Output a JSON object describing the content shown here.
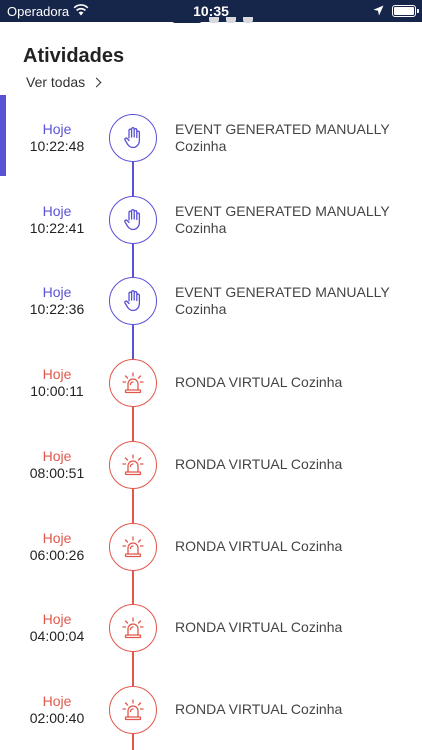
{
  "status_bar": {
    "carrier": "Operadora",
    "time": "10:35"
  },
  "section": {
    "title": "Atividades",
    "see_all": "Ver todas"
  },
  "colors": {
    "manual": "#5a52d5",
    "virtual": "#e0584c",
    "status_bar": "#16264a"
  },
  "activities": [
    {
      "type": "manual",
      "icon": "hand-icon",
      "day": "Hoje",
      "time": "10:22:48",
      "description": "EVENT GENERATED MANUALLY Cozinha"
    },
    {
      "type": "manual",
      "icon": "hand-icon",
      "day": "Hoje",
      "time": "10:22:41",
      "description": "EVENT GENERATED MANUALLY Cozinha"
    },
    {
      "type": "manual",
      "icon": "hand-icon",
      "day": "Hoje",
      "time": "10:22:36",
      "description": "EVENT GENERATED MANUALLY Cozinha"
    },
    {
      "type": "virtual",
      "icon": "siren-icon",
      "day": "Hoje",
      "time": "10:00:11",
      "description": "RONDA VIRTUAL Cozinha"
    },
    {
      "type": "virtual",
      "icon": "siren-icon",
      "day": "Hoje",
      "time": "08:00:51",
      "description": "RONDA VIRTUAL Cozinha"
    },
    {
      "type": "virtual",
      "icon": "siren-icon",
      "day": "Hoje",
      "time": "06:00:26",
      "description": "RONDA VIRTUAL Cozinha"
    },
    {
      "type": "virtual",
      "icon": "siren-icon",
      "day": "Hoje",
      "time": "04:00:04",
      "description": "RONDA VIRTUAL Cozinha"
    },
    {
      "type": "virtual",
      "icon": "siren-icon",
      "day": "Hoje",
      "time": "02:00:40",
      "description": "RONDA VIRTUAL Cozinha"
    }
  ]
}
